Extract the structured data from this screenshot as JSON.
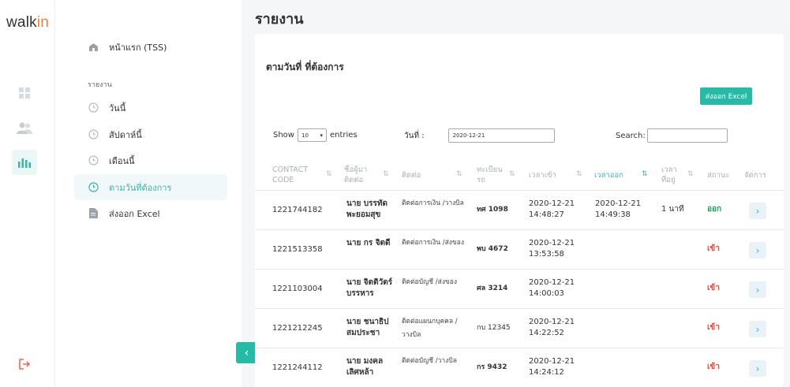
{
  "app": {
    "logo_main": "walk",
    "logo_accent": "in"
  },
  "menu": {
    "home_label": "หน้าแรก (TSS)",
    "section_label": "รายงาน",
    "items": [
      {
        "label": "วันนี้"
      },
      {
        "label": "สัปดาห์นี้"
      },
      {
        "label": "เดือนนี้"
      },
      {
        "label": "ตามวันที่ต้องการ"
      },
      {
        "label": "ส่งออก Excel"
      }
    ]
  },
  "page": {
    "title": "รายงาน"
  },
  "report": {
    "title": "ตามวันที่ ที่ต้องการ",
    "export_label": "ส่งออก Excel",
    "show_label": "Show",
    "entries_value": "10",
    "entries_label": "entries",
    "date_label": "วันที่ :",
    "date_value": "2020-12-21",
    "search_label": "Search:"
  },
  "table": {
    "headers": [
      {
        "label": "CONTACT CODE"
      },
      {
        "label": "ชื่อผู้มา ติดต่อ"
      },
      {
        "label": "ติดต่อ"
      },
      {
        "label": "ทะเบียน รถ"
      },
      {
        "label": "เวลาเข้า"
      },
      {
        "label": "เวลาออก"
      },
      {
        "label": "เวลา ที่อยู่"
      },
      {
        "label": "สถานะ"
      },
      {
        "label": "จัดการ"
      }
    ],
    "rows": [
      {
        "code": "1221744182",
        "name": "นาย บรรทัด พะยอมสุข",
        "contact": "ติดต่อการเงิน /วางบิล",
        "plate": "ทศ 1098",
        "time_in": "2020-12-21 14:48:27",
        "time_out": "2020-12-21 14:49:38",
        "duration": "1 นาที",
        "status": "ออก"
      },
      {
        "code": "1221513358",
        "name": "นาย กร จิตดี",
        "contact": "ติดต่อการเงิน /ส่งของ",
        "plate": "พบ 4672",
        "time_in": "2020-12-21 13:53:58",
        "time_out": "",
        "duration": "",
        "status": "เข้า"
      },
      {
        "code": "1221103004",
        "name": "นาย จิตติวัตร์ บรรหาร",
        "contact": "ติดต่อบัญชี /ส่งของ",
        "plate": "ศล 3214",
        "time_in": "2020-12-21 14:00:03",
        "time_out": "",
        "duration": "",
        "status": "เข้า"
      },
      {
        "code": "1221212245",
        "name": "นาย ชนาธิป สมประชา",
        "contact": "ติดต่อแผนกบุคคล /วางบิล",
        "plate": "กบ 12345",
        "time_in": "2020-12-21 14:22:52",
        "time_out": "",
        "duration": "",
        "status": "เข้า"
      },
      {
        "code": "1221244112",
        "name": "นาย มงคล เลิศหล้า",
        "contact": "ติดต่อบัญชี /วางบิล",
        "plate": "กร 9432",
        "time_in": "2020-12-21 14:24:12",
        "time_out": "",
        "duration": "",
        "status": "เข้า"
      }
    ]
  },
  "colors": {
    "accent": "#26bba6",
    "status_out": "#1f9a55",
    "status_in": "#e04a3f",
    "logo_accent": "#f07d2e"
  }
}
